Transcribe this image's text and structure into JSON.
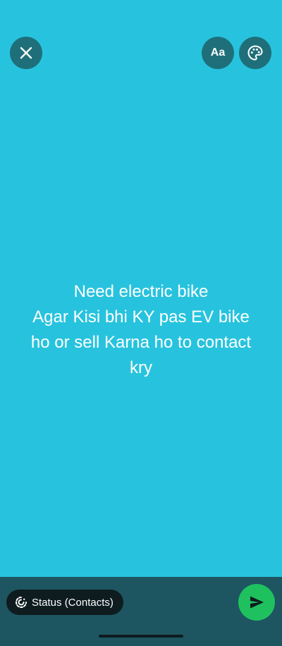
{
  "header": {
    "font_button_label": "Aa"
  },
  "status": {
    "text": "Need electric bike\nAgar Kisi bhi KY pas EV bike\nho or sell Karna ho to contact\nkry"
  },
  "footer": {
    "audience_label": "Status (Contacts)"
  },
  "icons": {
    "close": "close-icon",
    "palette": "palette-icon",
    "audience": "status-icon",
    "send": "send-icon"
  },
  "colors": {
    "background": "#27c3de",
    "button_bg": "#1f6f7a",
    "bottom_bar": "#1d5561",
    "pill_bg": "#0e1b1f",
    "send_bg": "#1fc15f"
  }
}
